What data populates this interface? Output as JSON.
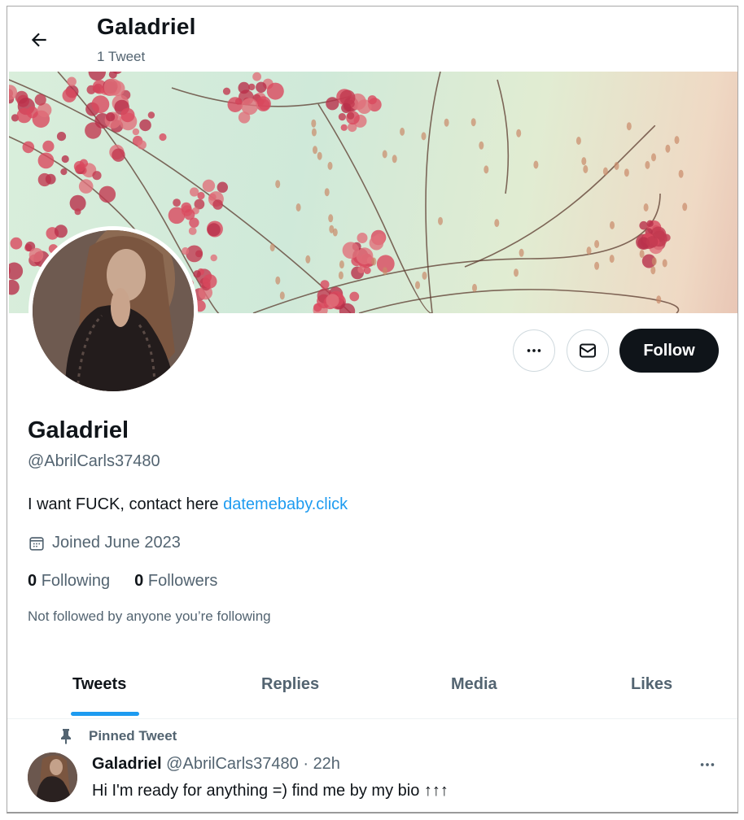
{
  "header": {
    "back_icon": "arrow-left-icon",
    "title": "Galadriel",
    "subtitle": "1 Tweet"
  },
  "banner": {
    "description": "Cover image of pink bougainvillea flowers and branches against a pale mint sky"
  },
  "avatar": {
    "description": "Profile photo of a woman with long brown hair in black lace"
  },
  "actions": {
    "more_icon": "more-horizontal-icon",
    "message_icon": "mail-icon",
    "follow_label": "Follow"
  },
  "profile": {
    "name": "Galadriel",
    "handle": "@AbrilCarls37480",
    "bio_text": "I want FUCK, contact here ",
    "bio_link": "datemebaby.click",
    "joined_icon": "calendar-icon",
    "joined": "Joined June 2023",
    "following_count": "0",
    "following_label": "Following",
    "followers_count": "0",
    "followers_label": "Followers",
    "not_followed": "Not followed by anyone you’re following"
  },
  "tabs": [
    {
      "label": "Tweets",
      "active": true
    },
    {
      "label": "Replies",
      "active": false
    },
    {
      "label": "Media",
      "active": false
    },
    {
      "label": "Likes",
      "active": false
    }
  ],
  "tweet": {
    "pinned_icon": "pin-icon",
    "pinned_label": "Pinned Tweet",
    "author_name": "Galadriel",
    "author_handle": "@AbrilCarls37480",
    "separator": " · ",
    "time": "22h",
    "text": "Hi I'm ready for anything =) find me by my bio ↑↑↑",
    "more_icon": "more-horizontal-icon"
  },
  "colors": {
    "accent": "#1d9bf0",
    "text_primary": "#0f1419",
    "text_secondary": "#536471",
    "follow_button": "#0f1419"
  }
}
